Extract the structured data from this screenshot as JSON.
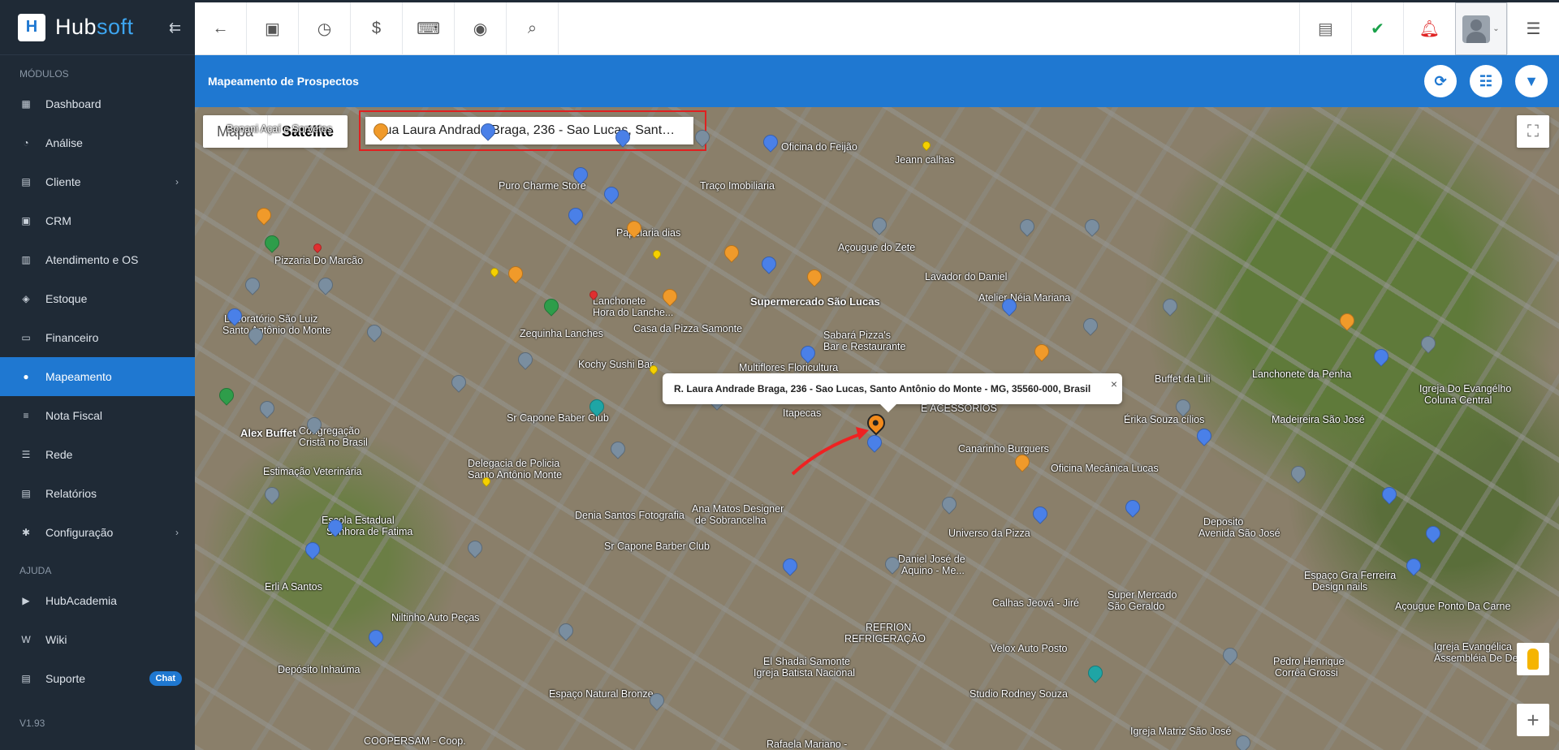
{
  "brand": {
    "name_a": "Hub",
    "name_b": "soft",
    "logo": "H"
  },
  "sidebar": {
    "section_modules": "MÓDULOS",
    "section_help": "AJUDA",
    "items": [
      {
        "label": "Dashboard",
        "icon": "dashboard-icon"
      },
      {
        "label": "Análise",
        "icon": "chart-pie-icon"
      },
      {
        "label": "Cliente",
        "icon": "client-card-icon"
      },
      {
        "label": "CRM",
        "icon": "crm-icon"
      },
      {
        "label": "Atendimento e OS",
        "icon": "calendar-icon"
      },
      {
        "label": "Estoque",
        "icon": "box-icon"
      },
      {
        "label": "Financeiro",
        "icon": "money-icon"
      },
      {
        "label": "Mapeamento",
        "icon": "map-pin-icon"
      },
      {
        "label": "Nota Fiscal",
        "icon": "invoice-icon"
      },
      {
        "label": "Rede",
        "icon": "network-icon"
      },
      {
        "label": "Relatórios",
        "icon": "report-icon"
      },
      {
        "label": "Configuração",
        "icon": "gear-icon"
      }
    ],
    "help_items": [
      {
        "label": "HubAcademia",
        "icon": "youtube-icon"
      },
      {
        "label": "Wiki",
        "icon": "wiki-icon"
      },
      {
        "label": "Suporte",
        "icon": "support-icon"
      }
    ],
    "chat_badge": "Chat",
    "version": "V1.93"
  },
  "page": {
    "title": "Mapeamento de Prospectos"
  },
  "map": {
    "type_map": "Mapa",
    "type_satellite": "Satélite",
    "search_value": "Rua Laura Andrade Braga, 236 - Sao Lucas, Sant…",
    "info_window": "R. Laura Andrade Braga, 236 - Sao Lucas, Santo Antônio do Monte - MG, 35560-000, Brasil",
    "labels": [
      "Bonani Açaí e Sorvetes",
      "Oficina do Feijão",
      "Jeann calhas",
      "Puro Charme Store",
      "Traço Imobiliaria",
      "Papelaria dias",
      "Pizzaria Do Marcão",
      "Açougue do Zete",
      "Lavador do Daniel",
      "Atelier Néia Mariana",
      "Laboratório São Luiz",
      "Santo Antônio do Monte",
      "Lanchonete",
      "Hora do Lanche...",
      "Supermercado São Lucas",
      "Zequinha Lanches",
      "Casa da Pizza Samonte",
      "Sabará Pizza's",
      "Bar e Restaurante",
      "Kochy Sushi Bar",
      "Multiflores Floricultura",
      "Buffet da Lili",
      "Lanchonete da Penha",
      "Igreja Do Evangélho",
      "Coluna Central",
      "Alex Buffet",
      "Congregação",
      "Cristã no Brasil",
      "Sr Capone Baber Club",
      "Itapecas",
      "E ACESSÓRIOS",
      "Érika Souza cílios",
      "Madeireira São José",
      "Estimação Veterinária",
      "Delegacia de Policia",
      "Santo Antônio Monte",
      "Canarinho Burguers",
      "Oficina Mecânica Lucas",
      "Denia Santos Fotografia",
      "Ana Matos Designer",
      "de Sobrancelha",
      "Escola Estadual",
      "Senhora de Fatima",
      "Sr Capone Barber Club",
      "Universo da Pizza",
      "Daniel José de",
      "Aquino - Me...",
      "Deposito",
      "Avenida São José",
      "Erli A Santos",
      "Espaço Gra Ferreira",
      "Design nails",
      "Açougue Ponto Da Carne",
      "Niltinho Auto Peças",
      "Calhas Jeová - Jiré",
      "Super Mercado",
      "São Geraldo",
      "REFRION",
      "REFRIGERAÇÃO",
      "Igreja Evangélica",
      "Assembléia De Deus",
      "Depósito Inhaúma",
      "El Shadai Samonte",
      "Igreja Batista Nacional",
      "Velox Auto Posto",
      "Pedro Henrique",
      "Corrêa Grossi",
      "Espaço Natural Bronze",
      "Studio Rodney Souza",
      "COOPERSAM - Coop.",
      "Rafaela Mariano -",
      "Igreja Matriz São José"
    ]
  }
}
